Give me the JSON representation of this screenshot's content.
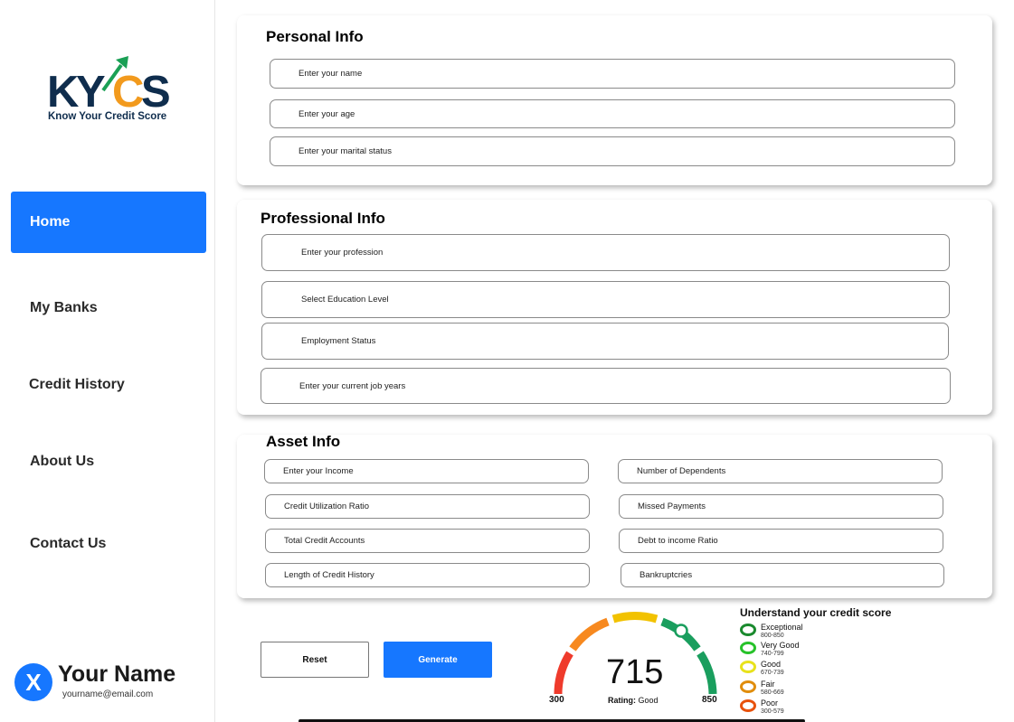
{
  "brand": {
    "logo_text": "KYCS",
    "tagline": "Know Your Credit Score"
  },
  "nav": [
    {
      "label": "Home",
      "active": true
    },
    {
      "label": "My Banks",
      "active": false
    },
    {
      "label": "Credit History",
      "active": false
    },
    {
      "label": "About Us",
      "active": false
    },
    {
      "label": "Contact Us",
      "active": false
    }
  ],
  "profile": {
    "initial": "X",
    "name": "Your Name",
    "email": "yourname@email.com"
  },
  "personal": {
    "title": "Personal Info",
    "fields": [
      "Enter your name",
      "Enter your age",
      "Enter your marital status"
    ]
  },
  "professional": {
    "title": "Professional Info",
    "fields": [
      "Enter your profession",
      "Select Education Level",
      "Employment Status",
      "Enter your current job years"
    ]
  },
  "asset": {
    "title": "Asset Info",
    "left_fields": [
      "Enter your Income",
      "Credit Utilization Ratio",
      "Total Credit Accounts",
      "Length of Credit History"
    ],
    "right_fields": [
      "Number of Dependents",
      "Missed Payments",
      "Debt to income Ratio",
      "Bankruptcries"
    ]
  },
  "actions": {
    "reset": "Reset",
    "generate": "Generate"
  },
  "gauge": {
    "score": "715",
    "rating_label": "Rating:",
    "rating_value": "Good",
    "min": "300",
    "max": "850",
    "colors": [
      "#ef3b2c",
      "#f7891f",
      "#f2c200",
      "#1a9e5e",
      "#1a9e5e"
    ]
  },
  "legend": {
    "title": "Understand your credit score",
    "items": [
      {
        "name": "Exceptional",
        "range": "800-850",
        "color": "#1a8a2e"
      },
      {
        "name": "Very Good",
        "range": "740-799",
        "color": "#27c22a"
      },
      {
        "name": "Good",
        "range": "670-739",
        "color": "#e8e21c"
      },
      {
        "name": "Fair",
        "range": "580-669",
        "color": "#e08d0c"
      },
      {
        "name": "Poor",
        "range": "300-579",
        "color": "#e8520d"
      }
    ]
  }
}
